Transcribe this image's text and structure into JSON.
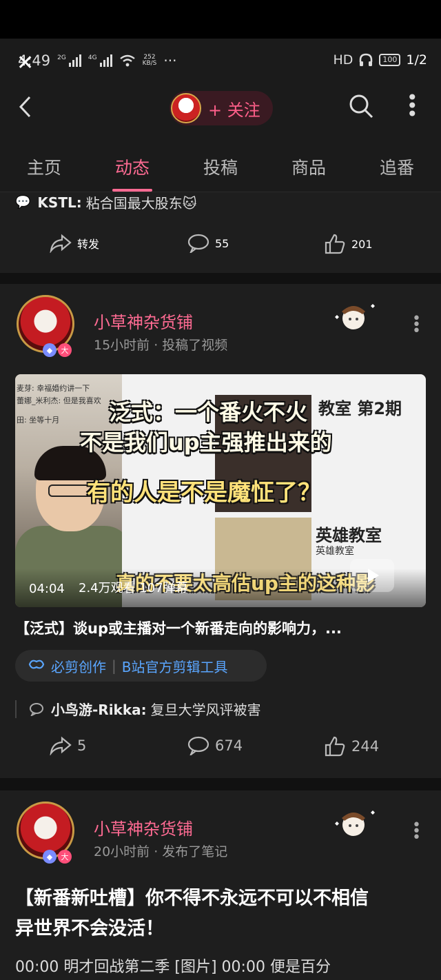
{
  "status": {
    "time": "4:49",
    "sig1": "2G",
    "sig2": "4G",
    "speed_value": "252",
    "speed_unit": "KB/S",
    "more": "···",
    "hd": "HD",
    "battery": "100",
    "page_counter": "1/2"
  },
  "header": {
    "back_icon": "chevron-left-icon",
    "follow_label": "+ 关注",
    "search_icon": "search-icon",
    "more_icon": "more-vertical-icon"
  },
  "tabs": [
    {
      "label": "主页",
      "active": false
    },
    {
      "label": "动态",
      "active": true
    },
    {
      "label": "投稿",
      "active": false
    },
    {
      "label": "商品",
      "active": false
    },
    {
      "label": "追番",
      "active": false
    }
  ],
  "post0": {
    "comment_user": "KSTL:",
    "comment_text": "粘合国最大股东🐱",
    "share_label": "转发",
    "comments": "55",
    "likes": "201"
  },
  "post1": {
    "username": "小草神杂货铺",
    "meta": "15小时前 · 投稿了视频",
    "video": {
      "sub1": "泛式：一个番火不火",
      "sub2": "不是我们up主强推出来的",
      "sub3": "有的人是不是魔怔了？",
      "sub4": "真的不要太高估up主的这种影",
      "screen_title1": "教室 第2期",
      "screen_title2": "英雄教室",
      "screen_sub2": "英雄教室",
      "left_note1": "麦芽: 幸福婚约讲一下",
      "left_note2": "蕾娜_米利杰: 但是我喜欢",
      "left_note3": "田: 坐等十月",
      "duration": "04:04",
      "stats": "2.4万观看  107弹幕"
    },
    "title": "【泛式】谈up或主播对一个新番走向的影响力，...",
    "tool_name": "必剪创作",
    "tool_desc": "B站官方剪辑工具",
    "comment_user": "小鸟游-Rikka:",
    "comment_text": "复旦大学风评被害",
    "shares": "5",
    "comments": "674",
    "likes": "244"
  },
  "post2": {
    "username": "小草神杂货铺",
    "meta": "20小时前 · 发布了笔记",
    "title_line1": "【新番新吐槽】你不得不永远不可以不相信",
    "title_line2": "异世界不会没活！",
    "preview": "00:00 明才回战第二季 [图片] 00:00 便是百分"
  }
}
